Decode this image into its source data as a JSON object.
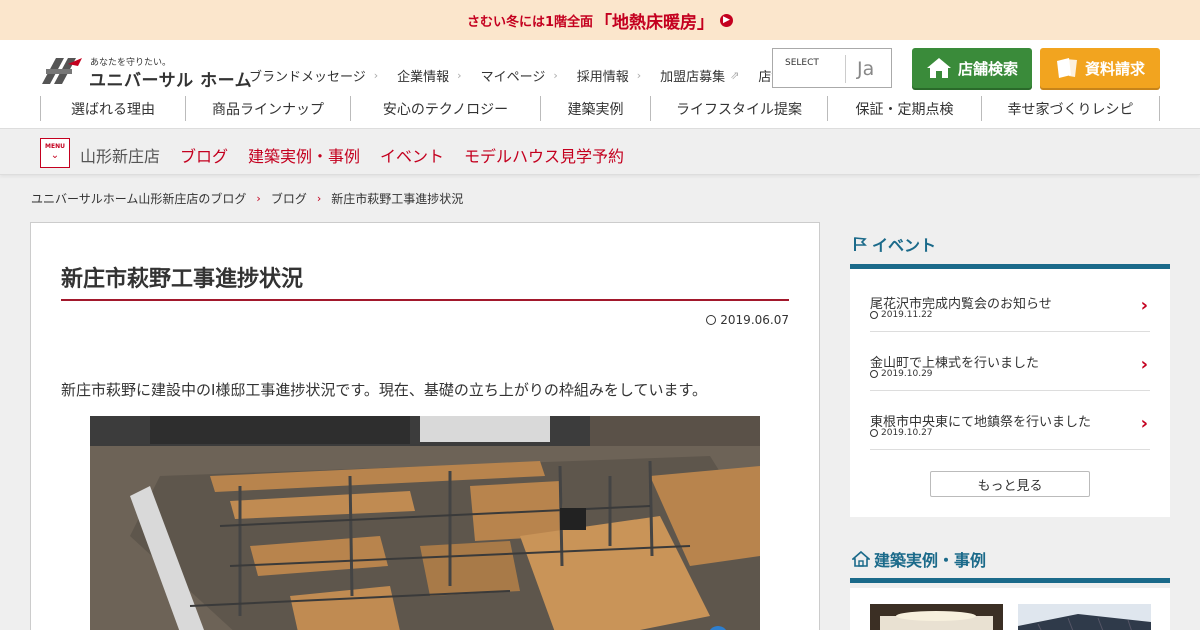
{
  "banner": {
    "text": "さむい冬には1階全面",
    "strong": "「地熱床暖房」"
  },
  "logo": {
    "tagline": "あなたを守りたい。",
    "name": "ユニバーサル ホーム"
  },
  "utility_nav": [
    {
      "label": "ブランドメッセージ",
      "suffix": "›"
    },
    {
      "label": "企業情報",
      "suffix": "›"
    },
    {
      "label": "マイページ",
      "suffix": "›"
    },
    {
      "label": "採用情報",
      "suffix": "›"
    },
    {
      "label": "加盟店募集",
      "suffix": "⇗"
    },
    {
      "label": "店舗採用情報",
      "suffix": "⇗"
    }
  ],
  "language": {
    "label": "SELECT",
    "value": "Ja"
  },
  "buttons": {
    "store_search": "店舗検索",
    "request_docs": "資料請求"
  },
  "main_nav": [
    "選ばれる理由",
    "商品ラインナップ",
    "安心のテクノロジー",
    "建築実例",
    "ライフスタイル提案",
    "保証・定期点検",
    "幸せ家づくりレシピ"
  ],
  "sub_bar": {
    "menu_label": "MENU",
    "store_name": "山形新庄店",
    "links": [
      "ブログ",
      "建築実例・事例",
      "イベント",
      "モデルハウス見学予約"
    ]
  },
  "breadcrumb": [
    "ユニバーサルホーム山形新庄店のブログ",
    "ブログ",
    "新庄市萩野工事進捗状況"
  ],
  "article": {
    "title": "新庄市萩野工事進捗状況",
    "date": "2019.06.07",
    "body": "新庄市萩野に建設中のI様邸工事進捗状況です。現在、基礎の立ち上がりの枠組みをしています。"
  },
  "sidebar": {
    "events_heading": "イベント",
    "events": [
      {
        "title": "尾花沢市完成内覧会のお知らせ",
        "date": "2019.11.22"
      },
      {
        "title": "金山町で上棟式を行いました",
        "date": "2019.10.29"
      },
      {
        "title": "東根市中央東にて地鎮祭を行いました",
        "date": "2019.10.27"
      }
    ],
    "more_label": "もっと見る",
    "cases_heading": "建築実例・事例"
  },
  "colors": {
    "brand_red": "#c4001f",
    "accent_blue": "#1b6a8a",
    "store_green": "#3a8b3a",
    "docs_orange": "#f2a41f"
  }
}
